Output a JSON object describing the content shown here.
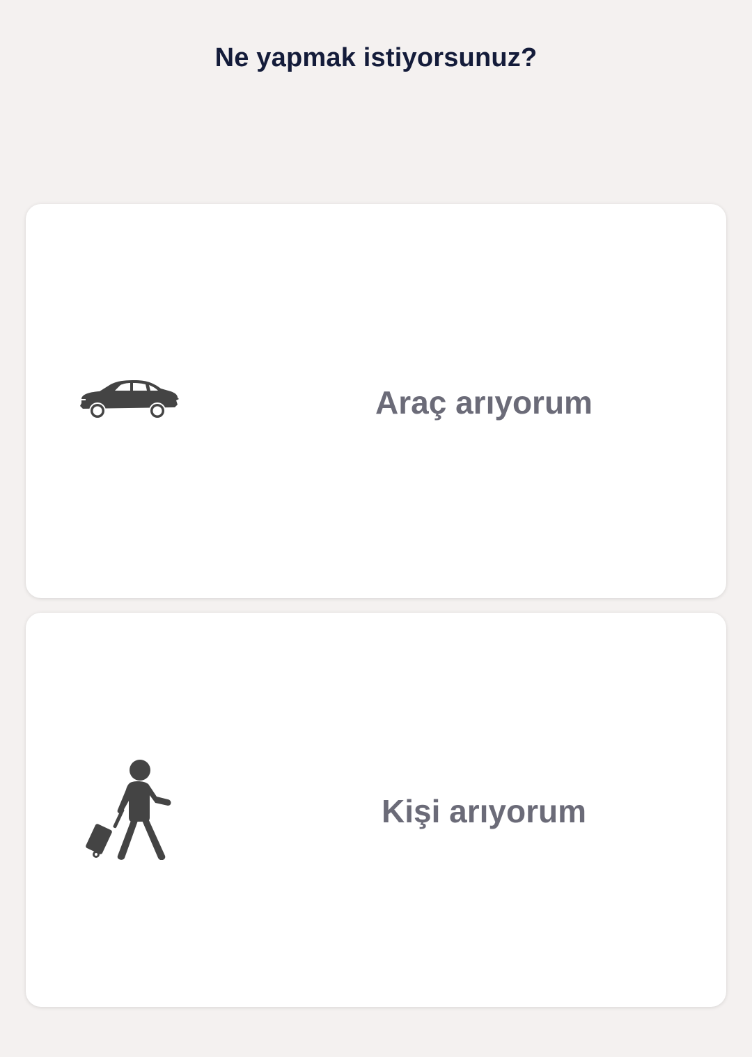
{
  "header": {
    "title": "Ne yapmak istiyorsunuz?"
  },
  "options": [
    {
      "label": "Araç arıyorum",
      "icon": "car-icon"
    },
    {
      "label": "Kişi arıyorum",
      "icon": "traveler-with-luggage-icon"
    }
  ],
  "colors": {
    "background": "#f4f1f0",
    "card": "#ffffff",
    "title": "#141c3a",
    "label": "#6b6b78",
    "icon": "#444444"
  }
}
